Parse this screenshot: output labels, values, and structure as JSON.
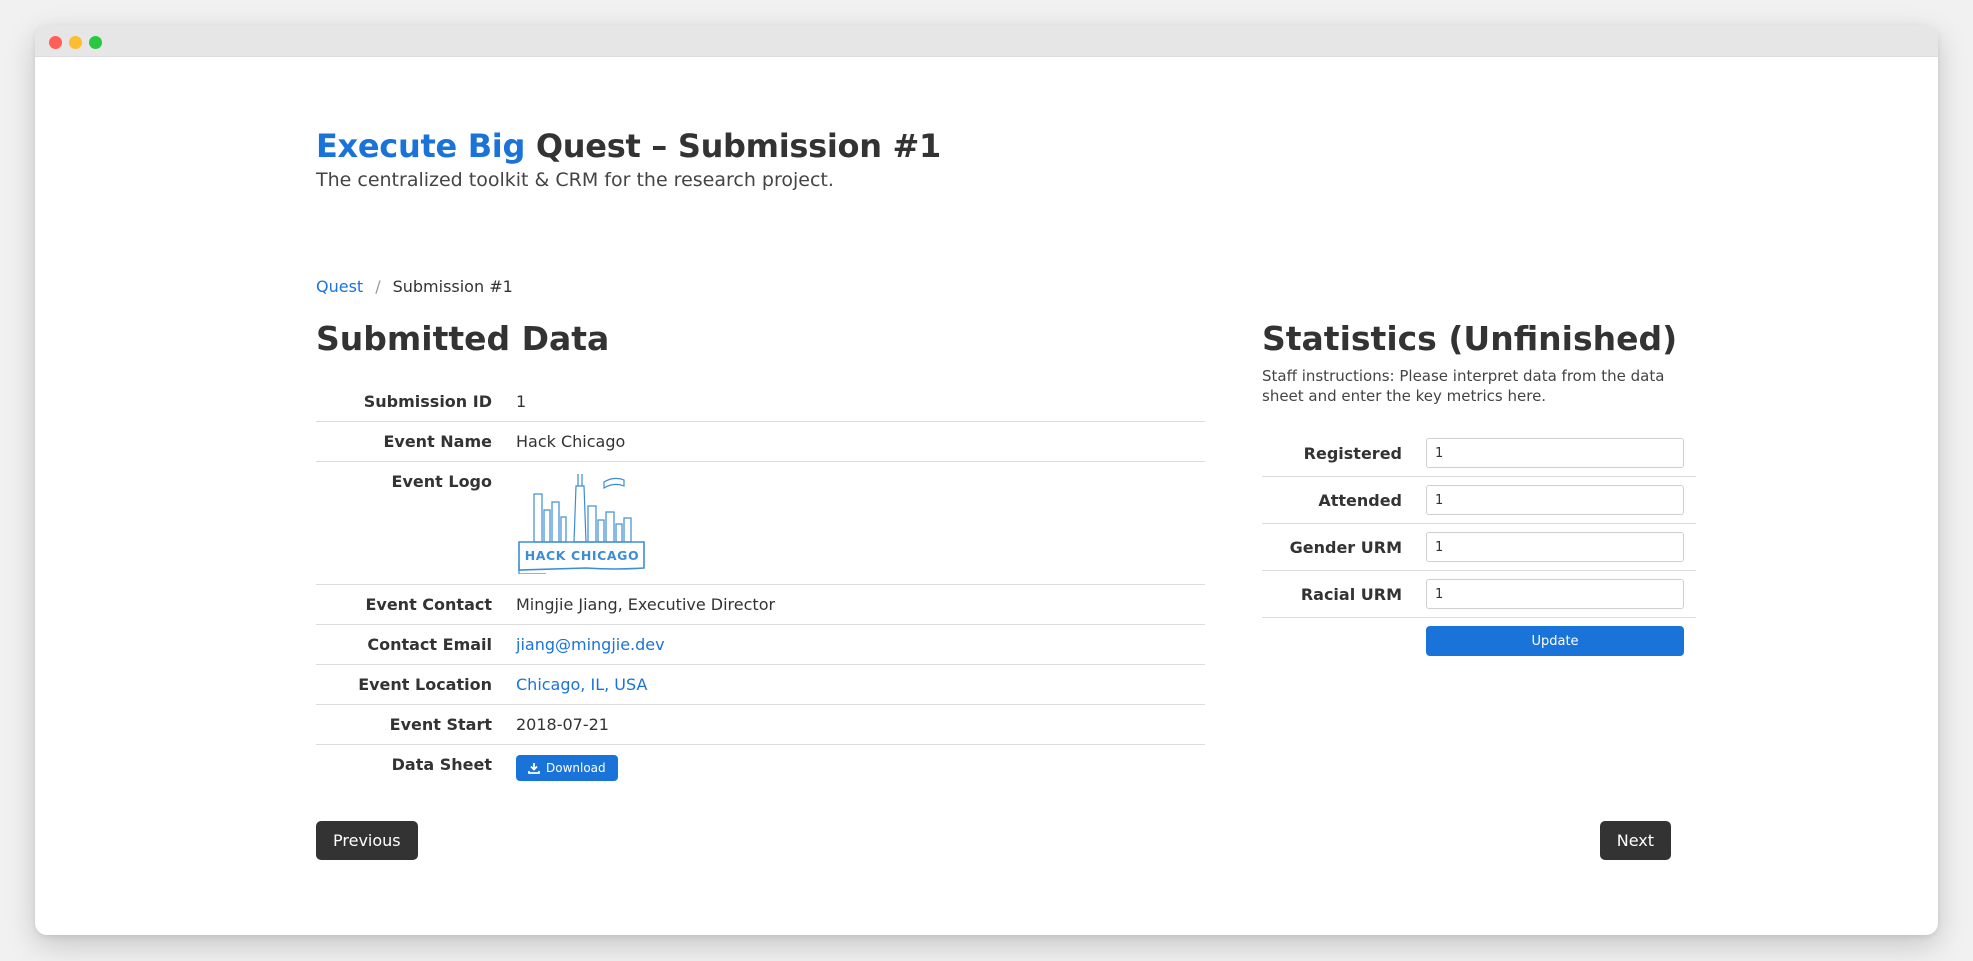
{
  "header": {
    "brand": "Execute Big",
    "title_rest": " Quest – Submission #1",
    "subtitle": "The centralized toolkit & CRM for the research project."
  },
  "breadcrumb": {
    "parent": "Quest",
    "separator": "/",
    "current": "Submission #1"
  },
  "submitted": {
    "title": "Submitted Data",
    "rows": {
      "submission_id": {
        "label": "Submission ID",
        "value": "1"
      },
      "event_name": {
        "label": "Event Name",
        "value": "Hack Chicago"
      },
      "event_logo": {
        "label": "Event Logo",
        "logo_text": "HACK CHICAGO"
      },
      "event_contact": {
        "label": "Event Contact",
        "value": "Mingjie Jiang, Executive Director"
      },
      "contact_email": {
        "label": "Contact Email",
        "value": "jiang@mingjie.dev"
      },
      "event_location": {
        "label": "Event Location",
        "value": "Chicago, IL, USA"
      },
      "event_start": {
        "label": "Event Start",
        "value": "2018-07-21"
      },
      "data_sheet": {
        "label": "Data Sheet",
        "button": "Download"
      }
    }
  },
  "stats": {
    "title": "Statistics (Unfinished)",
    "instructions": "Staff instructions: Please interpret data from the data sheet and enter the key metrics here.",
    "fields": {
      "registered": {
        "label": "Registered",
        "value": "1"
      },
      "attended": {
        "label": "Attended",
        "value": "1"
      },
      "gender_urm": {
        "label": "Gender URM",
        "value": "1"
      },
      "racial_urm": {
        "label": "Racial URM",
        "value": "1"
      }
    },
    "update_label": "Update"
  },
  "nav": {
    "previous": "Previous",
    "next": "Next"
  },
  "colors": {
    "brand": "#1a73d9",
    "dark_button": "#333333"
  }
}
